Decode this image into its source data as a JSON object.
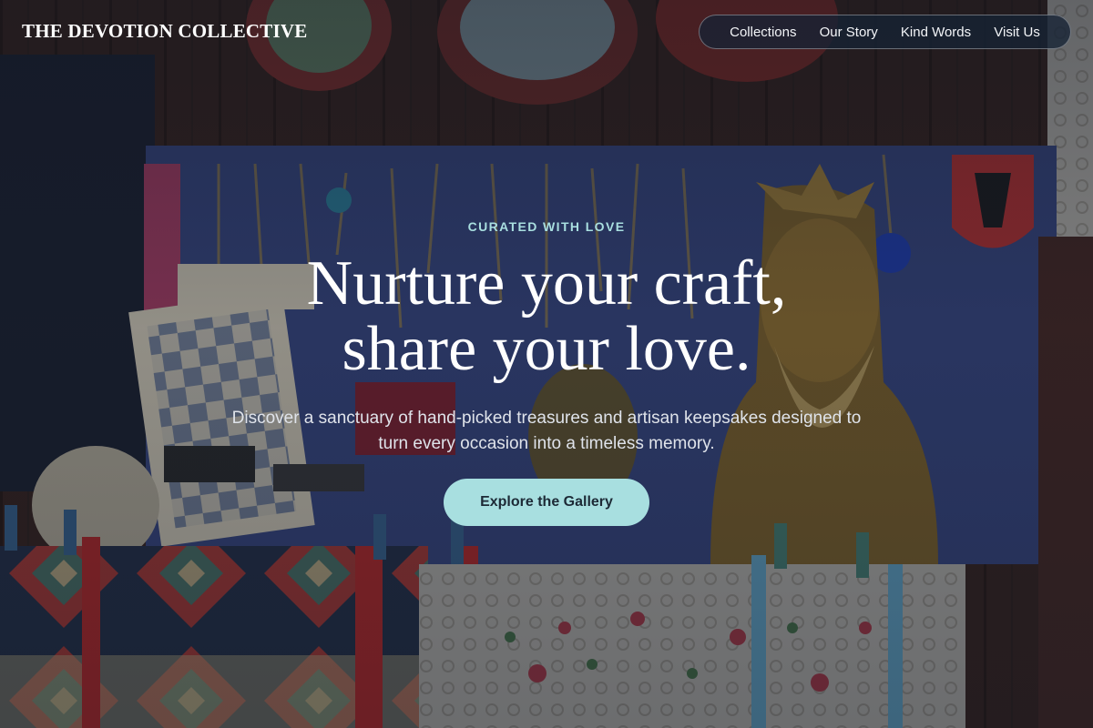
{
  "header": {
    "brand": "THE DEVOTION COLLECTIVE",
    "nav": [
      {
        "label": "Collections"
      },
      {
        "label": "Our Story"
      },
      {
        "label": "Kind Words"
      },
      {
        "label": "Visit Us"
      }
    ]
  },
  "hero": {
    "eyebrow": "CURATED WITH LOVE",
    "headline_line1": "Nurture your craft,",
    "headline_line2": "share your love.",
    "subtext": "Discover a sanctuary of hand-picked treasures and artisan keepsakes designed to turn every occasion into a timeless memory.",
    "cta_label": "Explore the Gallery"
  },
  "colors": {
    "accent": "#a8dfe0",
    "overlay": "#101622",
    "nav_bg": "#162234"
  }
}
